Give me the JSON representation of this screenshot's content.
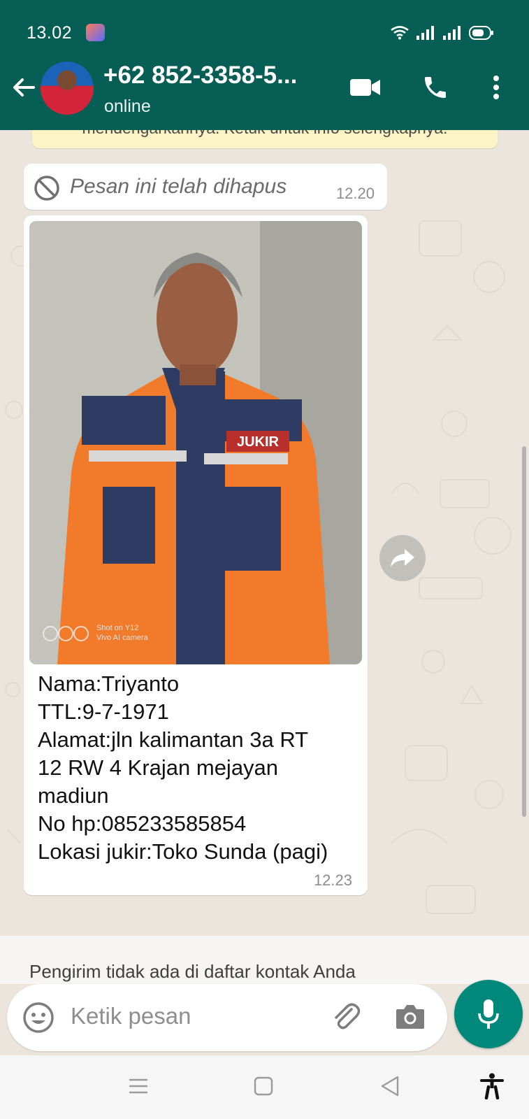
{
  "status_bar": {
    "time": "13.02"
  },
  "header": {
    "contact_name": "+62 852-3358-5...",
    "contact_status": "online"
  },
  "chat": {
    "info_banner": "mendengarkannya. Ketuk untuk info selengkapnya.",
    "deleted_message": {
      "text": "Pesan ini telah dihapus",
      "time": "12.20"
    },
    "photo_message": {
      "photo_watermark": [
        "Shot on Y12",
        "Vivo AI camera"
      ],
      "badge_text": "JUKIR",
      "caption_lines": [
        "Nama:Triyanto",
        "TTL:9-7-1971",
        "Alamat:jln kalimantan 3a RT",
        "12 RW 4 Krajan mejayan",
        "madiun",
        "No hp:085233585854",
        "Lokasi jukir:Toko Sunda (pagi)"
      ],
      "time": "12.23"
    },
    "unknown_sender_notice": "Pengirim tidak ada di daftar kontak Anda"
  },
  "input": {
    "placeholder": "Ketik pesan"
  },
  "colors": {
    "header": "#075e54",
    "accent": "#00897b",
    "chat_bg": "#ece5dd",
    "banner": "#fdf4c5"
  },
  "icons": [
    "back-arrow-icon",
    "video-call-icon",
    "phone-icon",
    "more-vert-icon",
    "ban-icon",
    "forward-icon",
    "emoji-icon",
    "attach-icon",
    "camera-icon",
    "mic-icon",
    "menu-icon",
    "home-icon",
    "back-icon",
    "accessibility-icon"
  ]
}
